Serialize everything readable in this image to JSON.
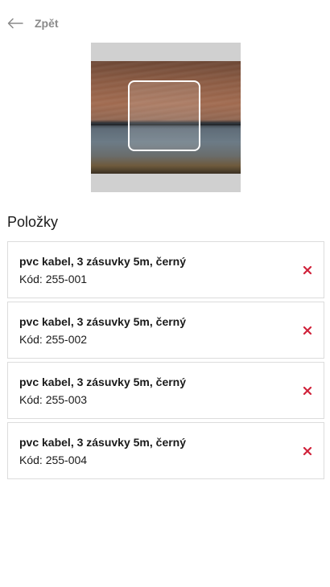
{
  "header": {
    "back_label": "Zpět",
    "back_icon": "arrow-left-icon"
  },
  "scanner": {
    "frame_icon": "scan-frame"
  },
  "items_section": {
    "title": "Položky"
  },
  "items": [
    {
      "name": "pvc kabel, 3 zásuvky 5m, černý",
      "code": "Kód: 255-001"
    },
    {
      "name": "pvc kabel, 3 zásuvky 5m, černý",
      "code": "Kód: 255-002"
    },
    {
      "name": "pvc kabel, 3 zásuvky 5m, černý",
      "code": "Kód: 255-003"
    },
    {
      "name": "pvc kabel, 3 zásuvky 5m, černý",
      "code": "Kód: 255-004"
    }
  ],
  "colors": {
    "remove_icon": "#d0223a",
    "back_label": "#8a8a8a",
    "card_border": "#dcdcdc"
  }
}
